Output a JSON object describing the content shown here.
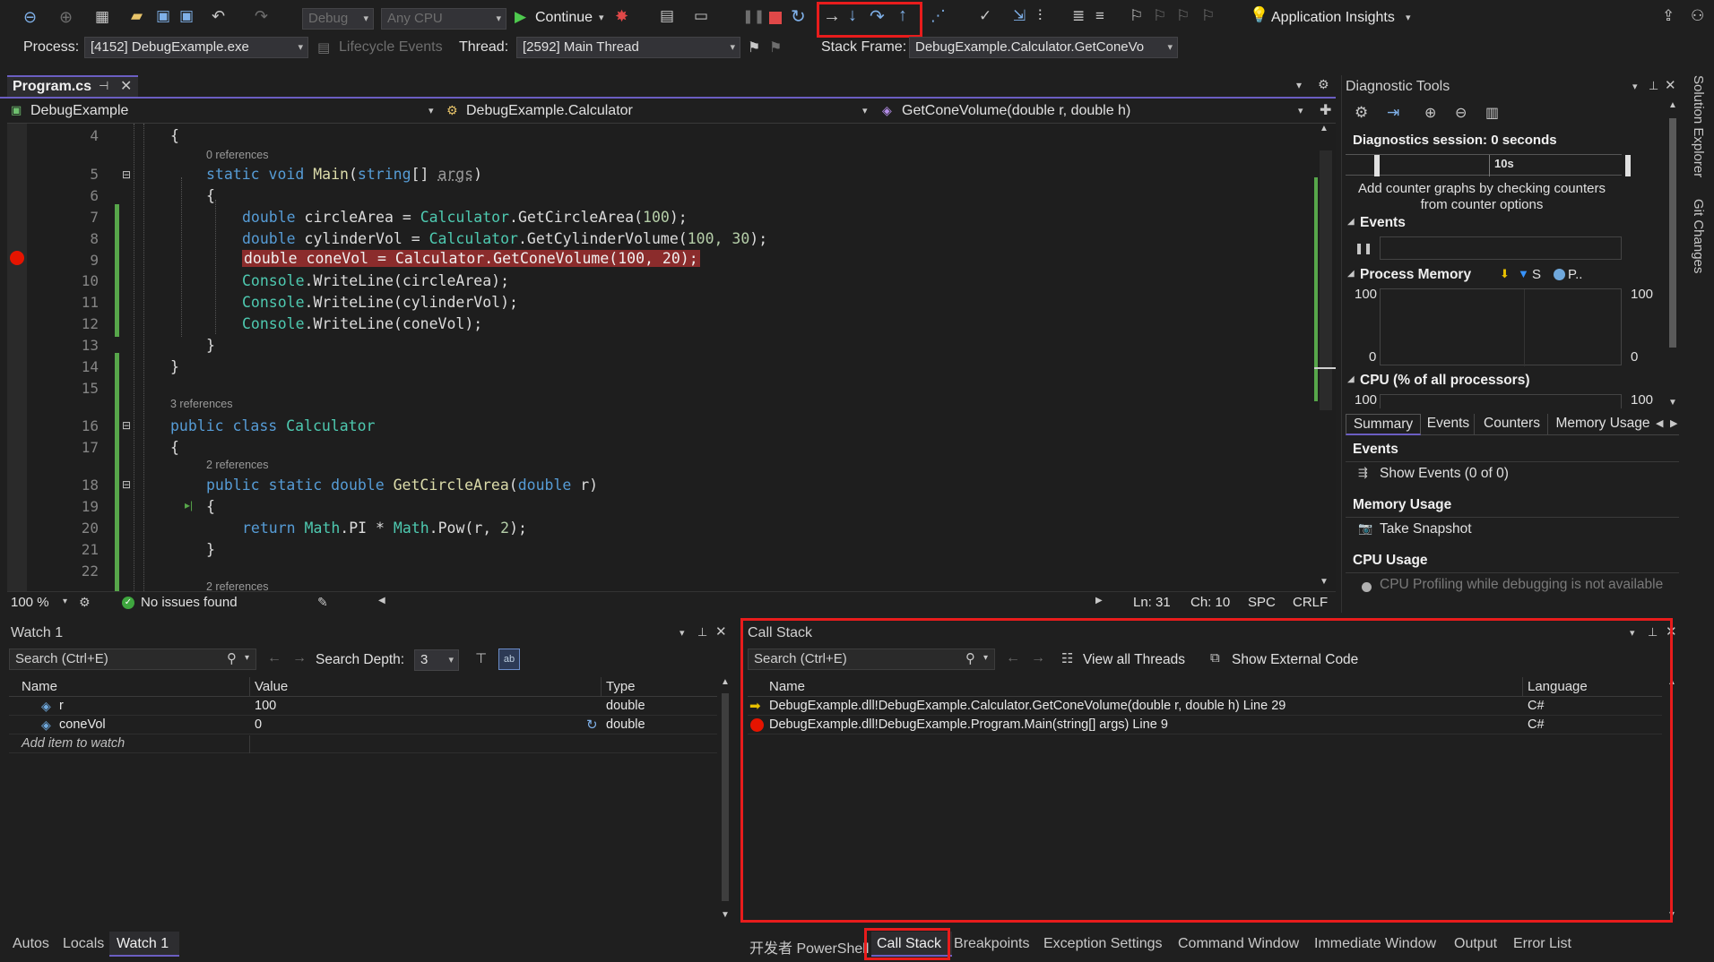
{
  "toolbar": {
    "config": "Debug",
    "platform": "Any CPU",
    "continue_label": "Continue",
    "app_insights_label": "Application Insights"
  },
  "debug_location": {
    "process_label": "Process:",
    "process_value": "[4152] DebugExample.exe",
    "lifecycle_label": "Lifecycle Events",
    "thread_label": "Thread:",
    "thread_value": "[2592] Main Thread",
    "stack_frame_label": "Stack Frame:",
    "stack_frame_value": "DebugExample.Calculator.GetConeVo"
  },
  "editor": {
    "tab_name": "Program.cs",
    "nav_project": "DebugExample",
    "nav_class": "DebugExample.Calculator",
    "nav_member": "GetConeVolume(double r, double h)",
    "line_numbers": [
      "4",
      "5",
      "6",
      "7",
      "8",
      "9",
      "10",
      "11",
      "12",
      "13",
      "14",
      "15",
      "16",
      "17",
      "18",
      "19",
      "20",
      "21",
      "22"
    ],
    "refs": {
      "main": "0 references",
      "calculator": "3 references",
      "circle": "2 references",
      "next": "2 references"
    },
    "code": {
      "l4": "{",
      "l5_kw": "static void ",
      "l5_fn": "Main",
      "l5_p1": "(",
      "l5_kw2": "string",
      "l5_p2": "[] ",
      "l5_arg": "args",
      "l5_p3": ")",
      "l6": "{",
      "l7_kw": "double ",
      "l7_var": "circleArea = ",
      "l7_ty": "Calculator",
      "l7_fn": ".GetCircleArea(",
      "l7_num": "100",
      "l7_end": ");",
      "l8_kw": "double ",
      "l8_var": "cylinderVol = ",
      "l8_ty": "Calculator",
      "l8_fn": ".GetCylinderVolume(",
      "l8_num": "100, 30",
      "l8_end": ");",
      "l9": "double coneVol = Calculator.GetConeVolume(100, 20);",
      "l10_ty": "Console",
      "l10_rest": ".WriteLine(circleArea);",
      "l11_ty": "Console",
      "l11_rest": ".WriteLine(cylinderVol);",
      "l12_ty": "Console",
      "l12_rest": ".WriteLine(coneVol);",
      "l13": "}",
      "l14": "}",
      "l16_kw": "public class ",
      "l16_ty": "Calculator",
      "l17": "{",
      "l18_kw": "public static double ",
      "l18_fn": "GetCircleArea",
      "l18_p1": "(",
      "l18_kw2": "double",
      "l18_p2": " r)",
      "l19": "{",
      "l20_kw": "return ",
      "l20_ty": "Math",
      "l20_a": ".PI * ",
      "l20_ty2": "Math",
      "l20_b": ".Pow(r, ",
      "l20_num": "2",
      "l20_c": ");",
      "l21": "}"
    },
    "status": {
      "zoom": "100 %",
      "issues": "No issues found",
      "ln": "Ln: 31",
      "ch": "Ch: 10",
      "spc": "SPC",
      "crlf": "CRLF"
    }
  },
  "diagnostic": {
    "title": "Diagnostic Tools",
    "session": "Diagnostics session: 0 seconds",
    "timeline_label": "10s",
    "hint": "Add counter graphs by checking counters from counter options",
    "events_label": "Events",
    "process_memory_label": "Process Memory",
    "legend_s": "S",
    "legend_p": "P..",
    "mem_max_left": "100",
    "mem_min_left": "0",
    "mem_max_right": "100",
    "mem_min_right": "0",
    "cpu_label": "CPU (% of all processors)",
    "cpu_max_left": "100",
    "cpu_max_right": "100",
    "tabs": [
      "Summary",
      "Events",
      "Counters",
      "Memory Usage"
    ],
    "summary_events": "Events",
    "show_events": "Show Events (0 of 0)",
    "memory_usage": "Memory Usage",
    "take_snapshot": "Take Snapshot",
    "cpu_usage": "CPU Usage",
    "cpu_note": "CPU Profiling while debugging is not available"
  },
  "watch": {
    "title": "Watch 1",
    "search_placeholder": "Search (Ctrl+E)",
    "search_depth_label": "Search Depth:",
    "search_depth_value": "3",
    "col_name": "Name",
    "col_value": "Value",
    "col_type": "Type",
    "rows": [
      {
        "name": "r",
        "value": "100",
        "type": "double"
      },
      {
        "name": "coneVol",
        "value": "0",
        "type": "double"
      }
    ],
    "add_item": "Add item to watch"
  },
  "callstack": {
    "title": "Call Stack",
    "search_placeholder": "Search (Ctrl+E)",
    "view_threads": "View all Threads",
    "show_external": "Show External Code",
    "col_name": "Name",
    "col_language": "Language",
    "rows": [
      {
        "name": "DebugExample.dll!DebugExample.Calculator.GetConeVolume(double r, double h) Line 29",
        "language": "C#"
      },
      {
        "name": "DebugExample.dll!DebugExample.Program.Main(string[] args) Line 9",
        "language": "C#"
      }
    ]
  },
  "bottom_tabs_left": [
    "Autos",
    "Locals",
    "Watch 1"
  ],
  "bottom_tabs_right": [
    "开发者 PowerShell",
    "Call Stack",
    "Breakpoints",
    "Exception Settings",
    "Command Window",
    "Immediate Window",
    "Output",
    "Error List"
  ],
  "side_tabs": [
    "Solution Explorer",
    "Git Changes"
  ]
}
